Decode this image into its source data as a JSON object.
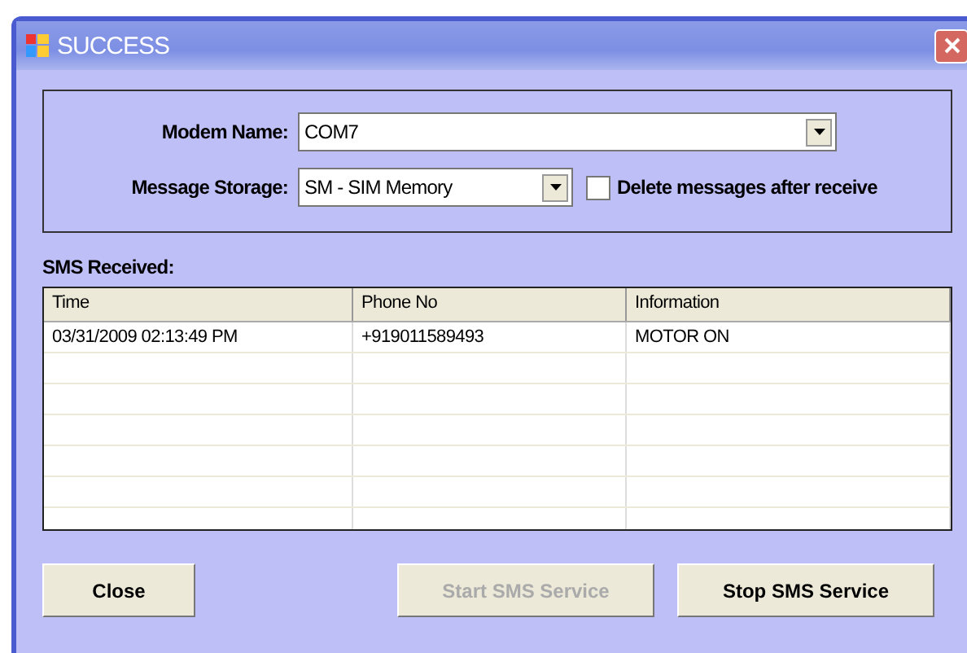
{
  "window": {
    "title": "SUCCESS"
  },
  "modem_name": {
    "label": "Modem Name:",
    "value": "COM7"
  },
  "message_storage": {
    "label": "Message Storage:",
    "value": "SM - SIM Memory"
  },
  "delete_after_receive": {
    "label": "Delete messages after receive",
    "checked": false
  },
  "sms_received": {
    "label": "SMS Received:",
    "columns": [
      "Time",
      "Phone No",
      "Information"
    ],
    "rows": [
      [
        "03/31/2009 02:13:49 PM",
        "+919011589493",
        "MOTOR ON"
      ]
    ]
  },
  "buttons": [
    {
      "label": "Close",
      "disabled": false
    },
    {
      "label": "Start SMS Service",
      "disabled": true
    },
    {
      "label": "Stop SMS Service",
      "disabled": false
    }
  ]
}
